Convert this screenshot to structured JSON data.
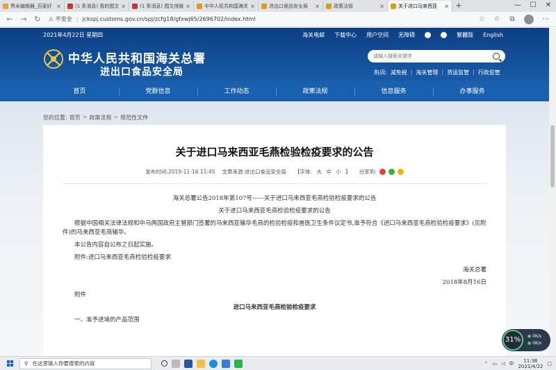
{
  "browser": {
    "tabs": [
      {
        "title": "秀米编辑器_百家好",
        "color": "#e6a23c",
        "active": false
      },
      {
        "title": "(1 条消息) 我的图文",
        "color": "#c0392b",
        "active": false
      },
      {
        "title": "(1 条消息) 图文排版",
        "color": "#c0392b",
        "active": false
      },
      {
        "title": "中华人民共和国海关",
        "color": "#d4a017",
        "active": false
      },
      {
        "title": "进出口食品安全局",
        "color": "#d4a017",
        "active": false
      },
      {
        "title": "政策法规",
        "color": "#d4a017",
        "active": false
      },
      {
        "title": "关于进口马来西亚",
        "color": "#d4a017",
        "active": true
      }
    ],
    "new_tab": "+",
    "window_controls": [
      "—",
      "☐",
      "✕"
    ],
    "insecure_label": "不安全",
    "url": "jckspj.customs.gov.cn/spj/zcfg18/gfxwj65/2696702/index.html"
  },
  "header": {
    "date": "2021年4月22日 星期四",
    "top_links": [
      "海关电邮",
      "下载中心",
      "用户空间",
      "无障碍"
    ],
    "lang_links": [
      "繁體版",
      "English"
    ],
    "logo_line1": "中华人民共和国海关总署",
    "logo_line2": "进出口食品安全局",
    "search_placeholder": "请输入搜索关键字",
    "hot_label": "热词:",
    "hot_words": [
      "减免税",
      "海关管理",
      "货运监管",
      "行政监管"
    ]
  },
  "nav": [
    "首页",
    "党群信息",
    "工作动态",
    "政策法规",
    "信息服务",
    "办事服务"
  ],
  "breadcrumb": {
    "label": "您的位置:",
    "items": [
      "首页",
      "政策法规",
      "规范性文件"
    ],
    "sep": ">"
  },
  "article": {
    "title": "关于进口马来西亚毛燕检验检疫要求的公告",
    "publish_time": "发布时间:2019-11-16 11:45",
    "source": "文章来源:进出口食品安全局",
    "font_label": "【字体:",
    "font_sizes": [
      "大",
      "中",
      "小"
    ],
    "font_close": "】",
    "share_label": "分享到:",
    "paragraphs": [
      {
        "type": "c",
        "text": "海关总署公告2018年第107号——关于进口马来西亚毛燕检验检疫要求的公告"
      },
      {
        "type": "c",
        "text": "关于进口马来西亚毛燕检验检疫要求的公告"
      },
      {
        "type": "p",
        "text": "根据中国相关法律法规和中马两国政府主管部门签署的马来西亚输华毛燕的检验检疫和兽医卫生条件议定书,准予符合《进口马来西亚毛燕检验检疫要求》(见附件)的马来西亚毛燕输华。"
      },
      {
        "type": "p",
        "text": "本公告内容自公布之日起实施。"
      },
      {
        "type": "p",
        "text": "附件:进口马来西亚毛燕检验检疫要求"
      },
      {
        "type": "r",
        "text": "海关总署"
      },
      {
        "type": "r",
        "text": "2018年8月16日"
      },
      {
        "type": "p",
        "text": "附件"
      },
      {
        "type": "b",
        "text": "进口马来西亚毛燕检验检疫要求"
      },
      {
        "type": "p",
        "text": "一、准予进境的产品范围"
      }
    ]
  },
  "widget": {
    "percent": "31%",
    "up": "0K/s",
    "down": "0K/s"
  },
  "taskbar": {
    "search_placeholder": "在这里输入你要搜索的内容",
    "time": "11:36",
    "date": "2021/4/22",
    "ime": "中"
  }
}
